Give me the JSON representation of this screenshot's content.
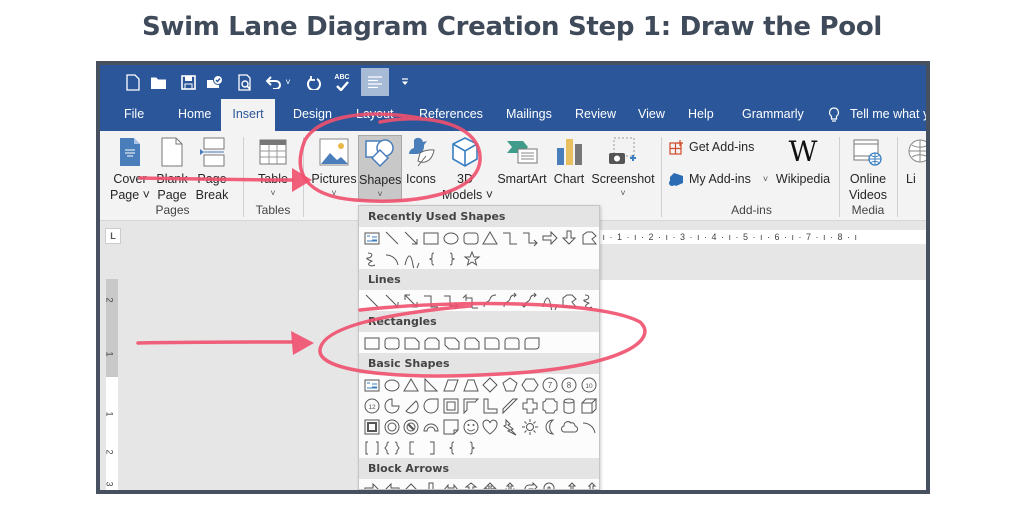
{
  "title": "Swim Lane Diagram Creation Step 1: Draw the Pool",
  "colors": {
    "title": "#3f4a5a",
    "ribbon_blue": "#2b579a",
    "annotation": "#f0506e"
  },
  "qat": {
    "icons": [
      "new-document-icon",
      "open-folder-icon",
      "save-icon",
      "print-icon",
      "print-preview-icon",
      "undo-icon",
      "redo-icon",
      "spelling-check-icon",
      "align-left-icon",
      "customize-qat-icon"
    ],
    "spelling_label": "ABC"
  },
  "tabs": [
    {
      "label": "File",
      "active": false
    },
    {
      "label": "Home",
      "active": false
    },
    {
      "label": "Insert",
      "active": true
    },
    {
      "label": "Design",
      "active": false
    },
    {
      "label": "Layout",
      "active": false
    },
    {
      "label": "References",
      "active": false
    },
    {
      "label": "Mailings",
      "active": false
    },
    {
      "label": "Review",
      "active": false
    },
    {
      "label": "View",
      "active": false
    },
    {
      "label": "Help",
      "active": false
    },
    {
      "label": "Grammarly",
      "active": false
    }
  ],
  "tell_me": "Tell me what y",
  "ribbon": {
    "buttons": {
      "cover_page": {
        "line1": "Cover",
        "line2": "Page ˅"
      },
      "blank_page": {
        "line1": "Blank",
        "line2": "Page"
      },
      "page_break": {
        "line1": "Page",
        "line2": "Break"
      },
      "table": {
        "line1": "Table",
        "chev": "˅"
      },
      "pictures": {
        "line1": "Pictures",
        "chev": "˅"
      },
      "shapes": {
        "line1": "Shapes",
        "chev": "˅"
      },
      "icons": {
        "line1": "Icons"
      },
      "models_3d": {
        "line1": "3D",
        "line2": "Models ˅"
      },
      "smartart": {
        "line1": "SmartArt"
      },
      "chart": {
        "line1": "Chart"
      },
      "screenshot": {
        "line1": "Screenshot",
        "chev": "˅"
      },
      "get_addins": {
        "label": "Get Add-ins"
      },
      "my_addins": {
        "label": "My Add-ins",
        "chev": "˅"
      },
      "wikipedia": {
        "line1": "Wikipedia",
        "glyph": "W"
      },
      "online_videos": {
        "line1": "Online",
        "line2": "Videos"
      },
      "links": {
        "line1": "Li"
      }
    },
    "groups": {
      "pages": "Pages",
      "tables": "Tables",
      "addins": "Add-ins",
      "media": "Media"
    }
  },
  "rulers": {
    "horizontal": "· ı · 1 · ı · 2 · ı · 3 · ı · 4 · ı · 5 · ı · 6 · ı · 7 · ı · 8 · ı",
    "vertical_labels": [
      "2",
      "1",
      "1",
      "2",
      "3"
    ],
    "tab_selector": "L"
  },
  "shapes_gallery": {
    "sections": [
      {
        "label": "Recently Used Shapes",
        "rows": [
          [
            "text-box",
            "line",
            "arrow-line",
            "rectangle",
            "oval",
            "rounded-rectangle",
            "triangle",
            "elbow-connector",
            "elbow-arrow-connector",
            "right-arrow",
            "down-arrow",
            "freeform"
          ],
          [
            "scribble",
            "arc",
            "curve",
            "left-brace",
            "right-brace",
            "star"
          ]
        ]
      },
      {
        "label": "Lines",
        "rows": [
          [
            "line",
            "arrow-line",
            "double-arrow-line",
            "elbow-connector",
            "elbow-arrow-connector",
            "elbow-double-arrow",
            "curved-connector",
            "curved-arrow-connector",
            "curved-double-arrow",
            "curve",
            "freeform",
            "scribble"
          ]
        ]
      },
      {
        "label": "Rectangles",
        "rows": [
          [
            "rectangle",
            "rounded-rectangle",
            "snip-single-corner",
            "snip-same-side",
            "snip-diagonal",
            "snip-round-single",
            "round-single-corner",
            "round-same-side",
            "round-diagonal"
          ]
        ]
      },
      {
        "label": "Basic Shapes",
        "rows": [
          [
            "text-box",
            "oval",
            "triangle",
            "right-triangle",
            "parallelogram",
            "trapezoid",
            "diamond",
            "pentagon",
            "hexagon",
            "heptagon",
            "octagon",
            "decagon"
          ],
          [
            "dodecagon",
            "pie",
            "chord",
            "teardrop",
            "frame",
            "half-frame",
            "l-shape",
            "diagonal-stripe",
            "cross",
            "plaque",
            "can",
            "cube"
          ],
          [
            "bevel",
            "donut",
            "no-symbol",
            "block-arc",
            "folded-corner",
            "smiley-face",
            "heart",
            "lightning-bolt",
            "sun",
            "moon",
            "cloud",
            "arc"
          ],
          [
            "double-bracket",
            "double-brace",
            "left-bracket",
            "right-bracket",
            "left-brace",
            "right-brace"
          ]
        ]
      },
      {
        "label": "Block Arrows",
        "rows": [
          [
            "right-arrow",
            "left-arrow",
            "up-arrow",
            "down-arrow",
            "left-right-arrow",
            "up-down-arrow",
            "quad-arrow",
            "left-right-up-arrow",
            "bent-arrow",
            "u-turn-arrow",
            "left-up-arrow",
            "bent-up-arrow"
          ]
        ]
      }
    ],
    "number_glyphs": {
      "heptagon": "7",
      "octagon": "8",
      "decagon": "10",
      "dodecagon": "12"
    }
  },
  "annotations": [
    {
      "type": "arrow",
      "target": "ribbon-insert-buttons"
    },
    {
      "type": "circle",
      "target": "shapes-button"
    },
    {
      "type": "arrow",
      "target": "rectangles-section"
    },
    {
      "type": "circle",
      "target": "rectangles-section"
    }
  ]
}
